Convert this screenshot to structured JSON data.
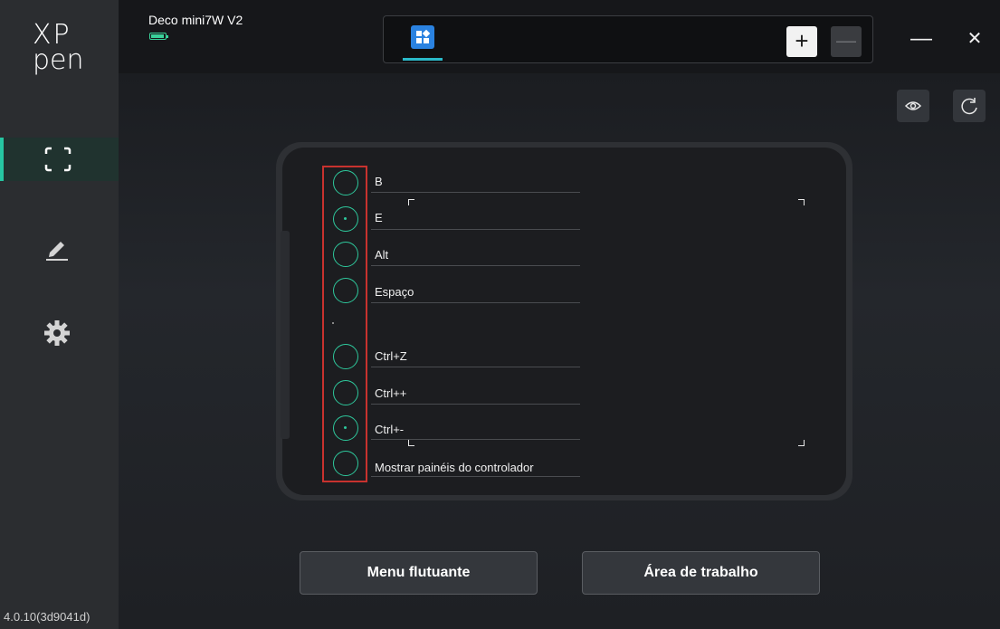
{
  "app": {
    "logo_line1": "XP",
    "logo_line2": "pen",
    "version": "4.0.10(3d9041d)"
  },
  "device": {
    "name": "Deco mini7W V2",
    "battery_level": 0.9
  },
  "tabs": {
    "add_label": "+",
    "remove_label": "—"
  },
  "window": {
    "minimize_label": "—",
    "close_label": "✕"
  },
  "sidebar": {
    "items": [
      {
        "name": "work-area",
        "icon": "frame-icon",
        "active": true
      },
      {
        "name": "pen",
        "icon": "pen-icon",
        "active": false
      },
      {
        "name": "settings",
        "icon": "gear-icon",
        "active": false
      }
    ]
  },
  "shortcut_keys": [
    {
      "label": "B"
    },
    {
      "label": "E"
    },
    {
      "label": "Alt"
    },
    {
      "label": "Espaço"
    },
    {
      "label": "Ctrl+Z"
    },
    {
      "label": "Ctrl++"
    },
    {
      "label": "Ctrl+-"
    },
    {
      "label": "Mostrar painéis do controlador"
    }
  ],
  "buttons": {
    "floating_menu": "Menu flutuante",
    "work_area": "Área de trabalho"
  },
  "colors": {
    "accent": "#26c6a2",
    "highlight_box": "#c8322e",
    "tab_icon": "#2a82e0"
  }
}
